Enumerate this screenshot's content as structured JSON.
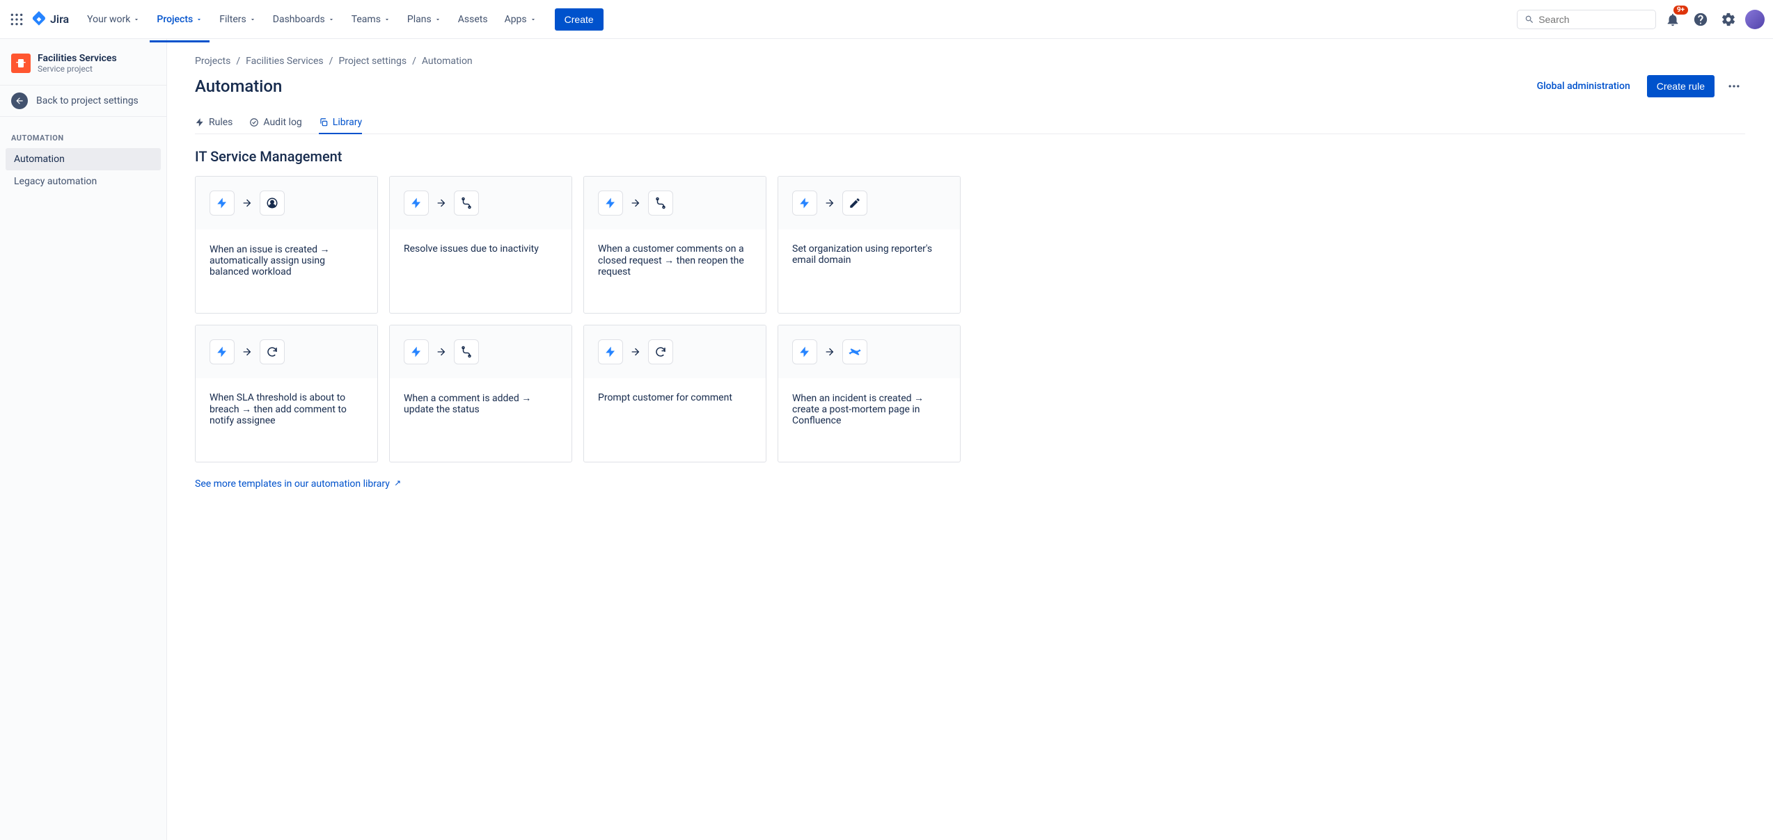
{
  "brand": "Jira",
  "nav": {
    "items": [
      "Your work",
      "Projects",
      "Filters",
      "Dashboards",
      "Teams",
      "Plans",
      "Assets",
      "Apps"
    ],
    "create": "Create"
  },
  "search": {
    "placeholder": "Search"
  },
  "notifications": {
    "badge": "9+"
  },
  "sidebar": {
    "project_name": "Facilities Services",
    "project_type": "Service project",
    "back": "Back to project settings",
    "section": "AUTOMATION",
    "items": [
      "Automation",
      "Legacy automation"
    ]
  },
  "breadcrumb": [
    "Projects",
    "Facilities Services",
    "Project settings",
    "Automation"
  ],
  "page": {
    "title": "Automation",
    "global_admin": "Global administration",
    "create_rule": "Create rule"
  },
  "tabs": [
    "Rules",
    "Audit log",
    "Library"
  ],
  "section_heading": "IT Service Management",
  "cards": [
    {
      "action": "assignee",
      "title": "When an issue is created → automatically assign using balanced workload"
    },
    {
      "action": "branch",
      "title": "Resolve issues due to inactivity"
    },
    {
      "action": "branch",
      "title": "When a customer comments on a closed request → then reopen the request"
    },
    {
      "action": "edit",
      "title": "Set organization using reporter's email domain"
    },
    {
      "action": "refresh",
      "title": "When SLA threshold is about to breach → then add comment to notify assignee"
    },
    {
      "action": "branch",
      "title": "When a comment is added → update the status"
    },
    {
      "action": "refresh",
      "title": "Prompt customer for comment"
    },
    {
      "action": "confluence",
      "title": "When an incident is created → create a post-mortem page in Confluence"
    }
  ],
  "library_link": "See more templates in our automation library"
}
